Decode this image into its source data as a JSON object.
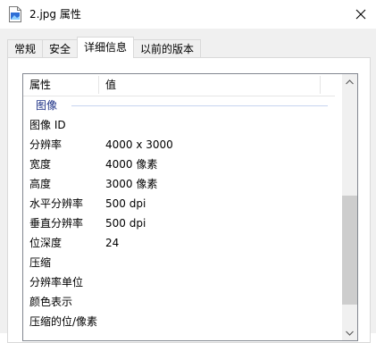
{
  "window": {
    "title": "2.jpg 属性",
    "file_icon": "image-file-icon",
    "close_icon": "close-icon"
  },
  "tabs": [
    {
      "label": "常规",
      "active": false
    },
    {
      "label": "安全",
      "active": false
    },
    {
      "label": "详细信息",
      "active": true
    },
    {
      "label": "以前的版本",
      "active": false
    }
  ],
  "list": {
    "columns": {
      "property": "属性",
      "value": "值"
    },
    "group": "图像",
    "rows": [
      {
        "name": "图像 ID",
        "value": ""
      },
      {
        "name": "分辨率",
        "value": "4000 x 3000"
      },
      {
        "name": "宽度",
        "value": "4000 像素"
      },
      {
        "name": "高度",
        "value": "3000 像素"
      },
      {
        "name": "水平分辨率",
        "value": "500 dpi"
      },
      {
        "name": "垂直分辨率",
        "value": "500 dpi"
      },
      {
        "name": "位深度",
        "value": "24"
      },
      {
        "name": "压缩",
        "value": ""
      },
      {
        "name": "分辨率单位",
        "value": ""
      },
      {
        "name": "颜色表示",
        "value": ""
      },
      {
        "name": "压缩的位/像素",
        "value": ""
      }
    ]
  },
  "scrollbar": {
    "up_icon": "scroll-up-arrow-icon",
    "down_icon": "scroll-down-arrow-icon"
  }
}
